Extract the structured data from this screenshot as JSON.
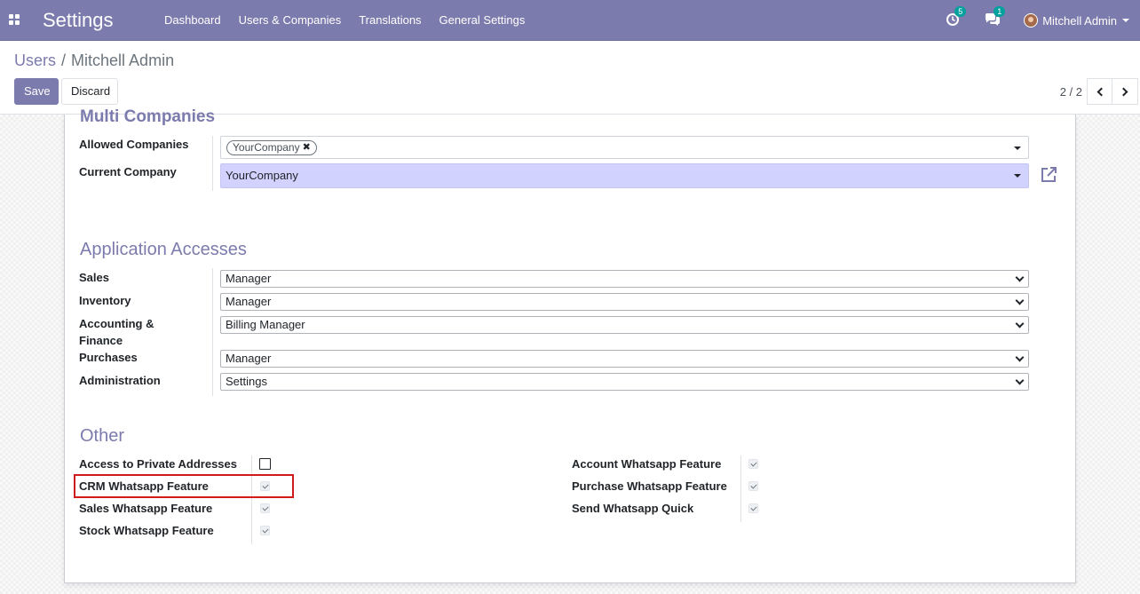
{
  "navbar": {
    "app_title": "Settings",
    "menu": [
      "Dashboard",
      "Users & Companies",
      "Translations",
      "General Settings"
    ],
    "activity_badge": "5",
    "messages_badge": "1",
    "user_name": "Mitchell Admin",
    "bg_color": "#7c7bad"
  },
  "control_panel": {
    "breadcrumb_parent": "Users",
    "breadcrumb_sep": "/",
    "breadcrumb_current": "Mitchell Admin",
    "save_label": "Save",
    "discard_label": "Discard",
    "pager": "2 / 2"
  },
  "multi_companies": {
    "title": "Multi Companies",
    "allowed_label": "Allowed Companies",
    "allowed_tag": "YourCompany",
    "current_label": "Current Company",
    "current_value": "YourCompany"
  },
  "app_access": {
    "title": "Application Accesses",
    "rows": [
      {
        "label": "Sales",
        "value": "Manager"
      },
      {
        "label": "Inventory",
        "value": "Manager"
      },
      {
        "label": "Accounting & Finance",
        "value": "Billing Manager"
      },
      {
        "label": "Purchases",
        "value": "Manager"
      },
      {
        "label": "Administration",
        "value": "Settings"
      }
    ]
  },
  "other": {
    "title": "Other",
    "left": [
      {
        "label": "Access to Private Addresses",
        "checked": false
      },
      {
        "label": "CRM Whatsapp Feature",
        "checked": true
      },
      {
        "label": "Sales Whatsapp Feature",
        "checked": true
      },
      {
        "label": "Stock Whatsapp Feature",
        "checked": true
      }
    ],
    "right": [
      {
        "label": "Account Whatsapp Feature",
        "checked": true
      },
      {
        "label": "Purchase Whatsapp Feature",
        "checked": true
      },
      {
        "label": "Send Whatsapp Quick",
        "checked": true
      }
    ]
  }
}
